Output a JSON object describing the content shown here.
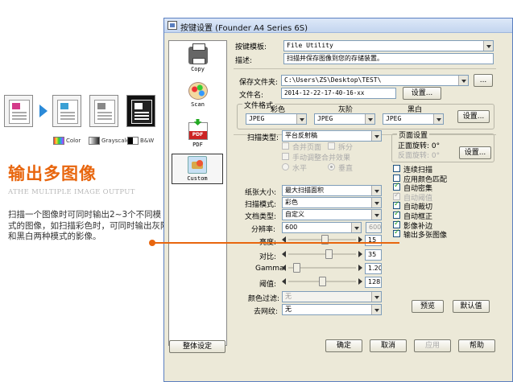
{
  "promo": {
    "title": "输出多图像",
    "subtitle": "ATHE MULTIPLE IMAGE OUTPUT",
    "description": "扫描一个图像时可同时输出2~3个不同模式的图像，如扫描彩色时，可同时输出灰阶和黑白两种模式的影像。",
    "legend": {
      "color": "Color",
      "grayscale": "Grayscale",
      "bw": "B&W"
    }
  },
  "window": {
    "title": "按键设置 (Founder A4 Series 6S)"
  },
  "modes": [
    {
      "label": "Copy",
      "icon": "printer-icon"
    },
    {
      "label": "Scan",
      "icon": "palette-icon"
    },
    {
      "label": "PDF",
      "icon": "pdf-icon"
    },
    {
      "label": "Custom",
      "icon": "custom-scan-icon",
      "selected": true
    }
  ],
  "top": {
    "template_label": "按键模板:",
    "template_value": "File Utility",
    "desc_label": "描述:",
    "desc_value": "扫描并保存图像到您的存储装置。"
  },
  "save": {
    "folder_label": "保存文件夹:",
    "folder_value": "C:\\Users\\ZS\\Desktop\\TEST\\",
    "browse_label": "...",
    "filename_label": "文件名:",
    "filename_value": "2014-12-22-17-40-16-xx",
    "settings_label": "设置...",
    "format_group": "文件格式",
    "color_label": "彩色",
    "gray_label": "灰阶",
    "bw_label": "黑白",
    "color_format": "JPEG",
    "gray_format": "JPEG",
    "bw_format": "JPEG",
    "format_settings_label": "设置..."
  },
  "scan": {
    "type_label": "扫描类型:",
    "type_value": "平台反射稿",
    "merge_label": "合并页面",
    "split_label": "拆分",
    "manual_merge_label": "手动调整合并效果",
    "horizontal_label": "水平",
    "vertical_label": "垂直"
  },
  "page": {
    "group": "页面设置",
    "front_rotate": "正面旋转: 0°",
    "back_rotate": "反面旋转: 0°",
    "settings_label": "设置..."
  },
  "options": [
    {
      "label": "连续扫描",
      "checked": false,
      "disabled": false
    },
    {
      "label": "应用颜色匹配",
      "checked": false,
      "disabled": false
    },
    {
      "label": "自动密集",
      "checked": true,
      "disabled": false
    },
    {
      "label": "自动阈值",
      "checked": true,
      "disabled": true
    },
    {
      "label": "自动裁切",
      "checked": true,
      "disabled": false
    },
    {
      "label": "自动框正",
      "checked": true,
      "disabled": false
    },
    {
      "label": "影像补边",
      "checked": true,
      "disabled": false
    },
    {
      "label": "输出多张图像",
      "checked": true,
      "disabled": false
    }
  ],
  "params": {
    "paper_size_label": "纸张大小:",
    "paper_size_value": "最大扫描面积",
    "scan_mode_label": "扫描模式:",
    "scan_mode_value": "彩色",
    "doc_type_label": "文档类型:",
    "doc_type_value": "自定义",
    "resolution_label": "分辨率:",
    "resolution_value": "600",
    "resolution_max": "600",
    "brightness_label": "亮度:",
    "brightness_value": "15",
    "contrast_label": "对比:",
    "contrast_value": "35",
    "gamma_label": "Gamma:",
    "gamma_value": "1.20",
    "threshold_label": "阈值:",
    "threshold_value": "128",
    "color_filter_label": "颜色过滤:",
    "color_filter_value": "无",
    "descreen_label": "去网纹:",
    "descreen_value": "无",
    "sliders": {
      "brightness": 0.54,
      "contrast": 0.6,
      "gamma": 0.12,
      "threshold": 0.5
    }
  },
  "actions": {
    "preview_label": "预览",
    "default_label": "默认值",
    "overall_label": "整体设定",
    "ok_label": "确定",
    "cancel_label": "取消",
    "apply_label": "应用",
    "help_label": "帮助"
  },
  "colors": {
    "accent": "#e8660e",
    "arrow": "#2b8ad8",
    "window_bg": "#ece9d8"
  }
}
